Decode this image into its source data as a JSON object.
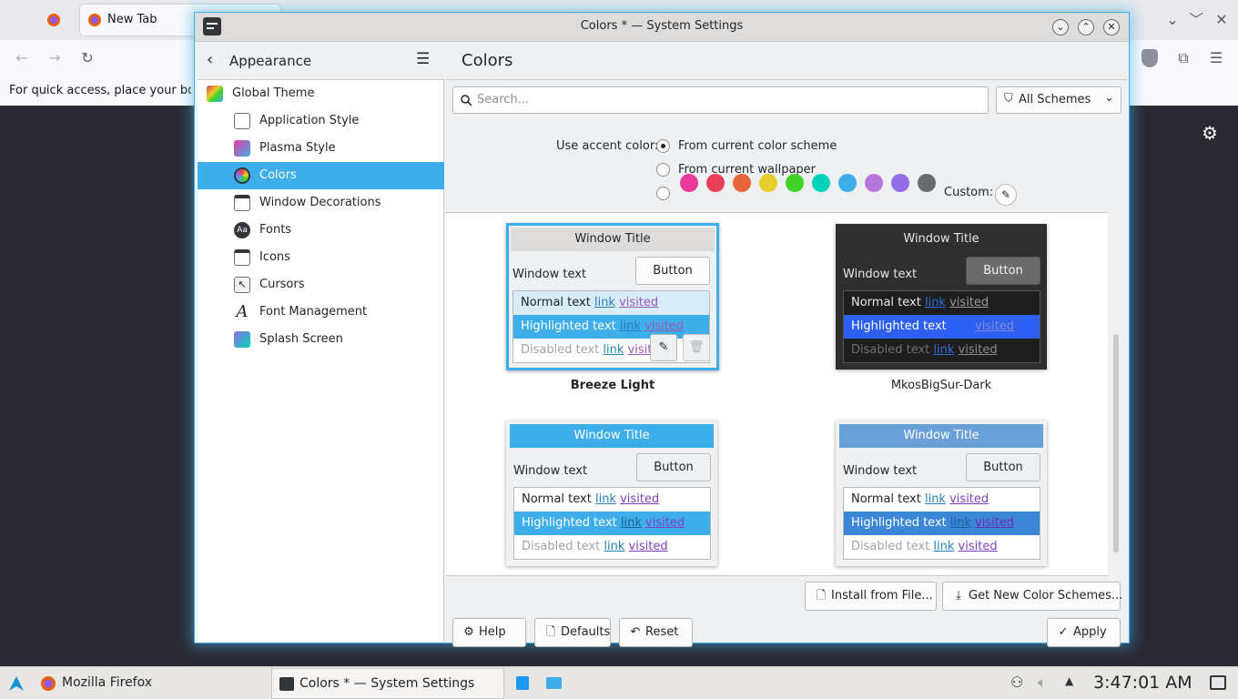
{
  "firefox": {
    "tab_label": "New Tab",
    "bookmark_hint": "For quick access, place your boo"
  },
  "window": {
    "title": "Colors * — System Settings"
  },
  "sidebar": {
    "back_label": "Appearance",
    "items": [
      {
        "label": "Global Theme",
        "icon": "global-theme-icon"
      },
      {
        "label": "Application Style",
        "icon": "application-style-icon"
      },
      {
        "label": "Plasma Style",
        "icon": "plasma-style-icon"
      },
      {
        "label": "Colors",
        "icon": "colors-icon",
        "selected": true
      },
      {
        "label": "Window Decorations",
        "icon": "window-decorations-icon"
      },
      {
        "label": "Fonts",
        "icon": "fonts-icon"
      },
      {
        "label": "Icons",
        "icon": "icons-icon"
      },
      {
        "label": "Cursors",
        "icon": "cursors-icon"
      },
      {
        "label": "Font Management",
        "icon": "font-management-icon"
      },
      {
        "label": "Splash Screen",
        "icon": "splash-screen-icon"
      }
    ]
  },
  "main": {
    "title": "Colors",
    "search_placeholder": "Search...",
    "filter_label": "All Schemes",
    "accent": {
      "label": "Use accent color:",
      "option_scheme": "From current color scheme",
      "option_wallpaper": "From current wallpaper",
      "custom_label": "Custom:",
      "swatches": [
        "#e93a9a",
        "#e93d58",
        "#e9643a",
        "#e8cb2d",
        "#3dd425",
        "#00d3b8",
        "#3daee9",
        "#b875dc",
        "#926ee4",
        "#686b6f"
      ]
    },
    "schemes": [
      {
        "title_bar": "Window Title",
        "window_text": "Window text",
        "button": "Button",
        "normal": "Normal text",
        "highlighted": "Highlighted text",
        "disabled": "Disabled text",
        "link": "link",
        "visited": "visited",
        "name": "Breeze Light"
      },
      {
        "title_bar": "Window Title",
        "window_text": "Window text",
        "button": "Button",
        "normal": "Normal text",
        "highlighted": "Highlighted text",
        "disabled": "Disabled text",
        "link": "link",
        "visited": "visited",
        "name": "MkosBigSur-Dark"
      },
      {
        "title_bar": "Window Title",
        "window_text": "Window text",
        "button": "Button",
        "normal": "Normal text",
        "highlighted": "Highlighted text",
        "disabled": "Disabled text",
        "link": "link",
        "visited": "visited"
      },
      {
        "title_bar": "Window Title",
        "window_text": "Window text",
        "button": "Button",
        "normal": "Normal text",
        "highlighted": "Highlighted text",
        "disabled": "Disabled text",
        "link": "link",
        "visited": "visited"
      }
    ],
    "install_button": "Install from File...",
    "get_new_button": "Get New Color Schemes...",
    "help_button": "Help",
    "defaults_button": "Defaults",
    "reset_button": "Reset",
    "apply_button": "Apply"
  },
  "taskbar": {
    "firefox_label": "Mozilla Firefox",
    "settings_label": "Colors * — System Settings",
    "clock": "3:47:01 AM"
  }
}
